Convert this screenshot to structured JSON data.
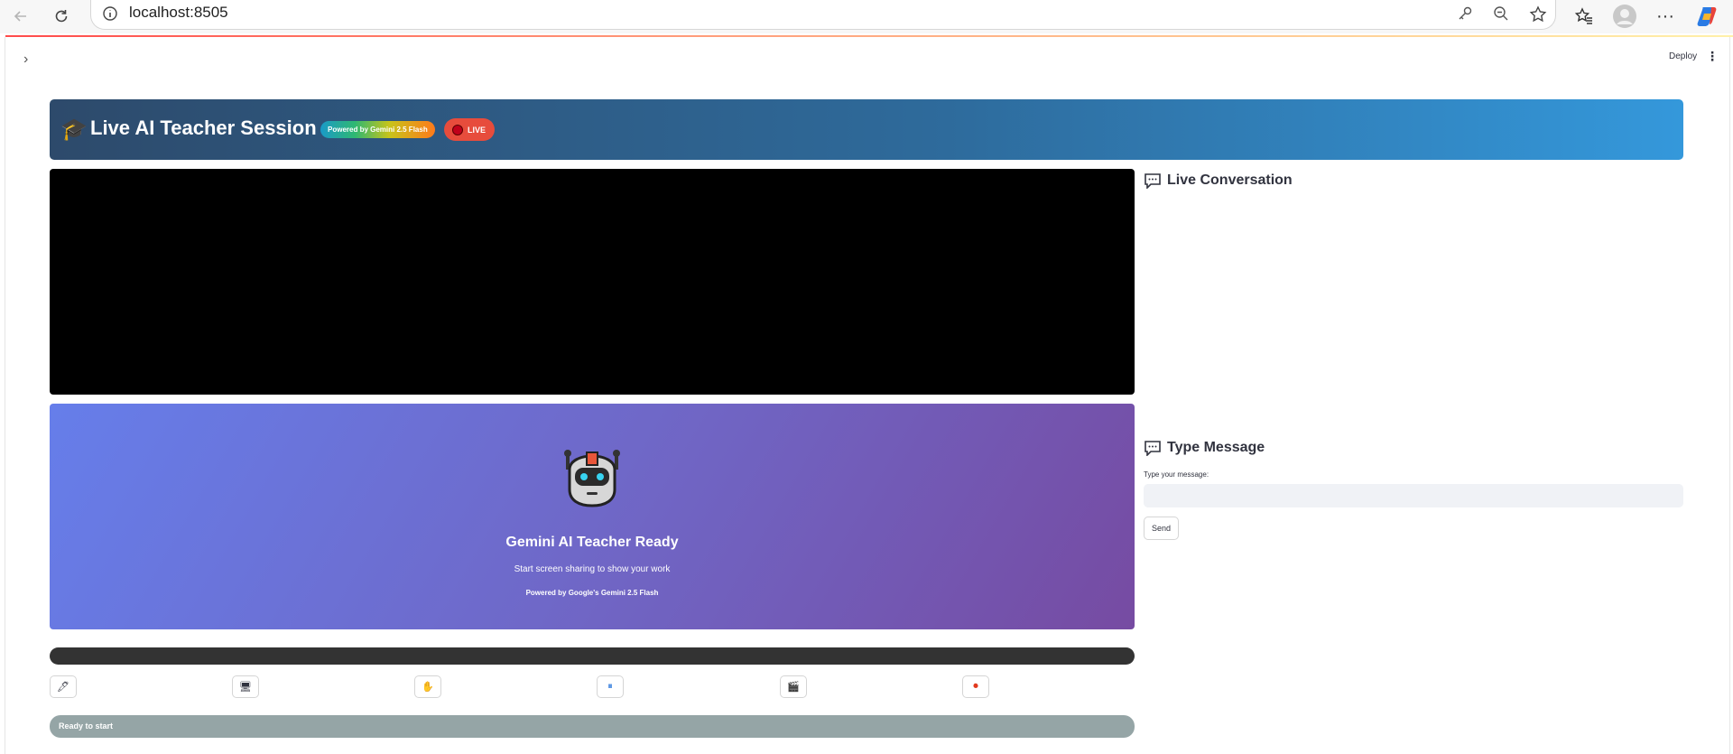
{
  "browser": {
    "url": "localhost:8505"
  },
  "app": {
    "deploy_label": "Deploy",
    "sidebar_toggle": "›",
    "menu_icon": "⋮"
  },
  "hero": {
    "icon": "🎓",
    "title": "Live AI Teacher Session",
    "badge_powered": "Powered by Gemini 2.5 Flash",
    "badge_live": "LIVE"
  },
  "ready_panel": {
    "title": "Gemini AI Teacher Ready",
    "subtitle": "Start screen sharing to show your work",
    "powered": "Powered by Google's Gemini 2.5 Flash"
  },
  "toolbar": {
    "buttons": [
      {
        "icon": "pen-icon",
        "glyph": "🖊"
      },
      {
        "icon": "monitor-icon",
        "glyph": "🖥"
      },
      {
        "icon": "hand-icon",
        "glyph": "✋"
      },
      {
        "icon": "pause-icon",
        "glyph": "⏸"
      },
      {
        "icon": "clapper-icon",
        "glyph": "🎬"
      },
      {
        "icon": "record-icon",
        "glyph": "⏺"
      }
    ]
  },
  "status": {
    "text": "Ready to start"
  },
  "conversation": {
    "title": "Live Conversation"
  },
  "message": {
    "title": "Type Message",
    "label": "Type your message:",
    "value": "",
    "send_label": "Send"
  },
  "colors": {
    "hero_start": "#2d4a6b",
    "hero_end": "#3498db",
    "live_red": "#e74c3c",
    "ready_start": "#667eea",
    "ready_end": "#764ba2",
    "status_gray": "#95a5a6"
  }
}
